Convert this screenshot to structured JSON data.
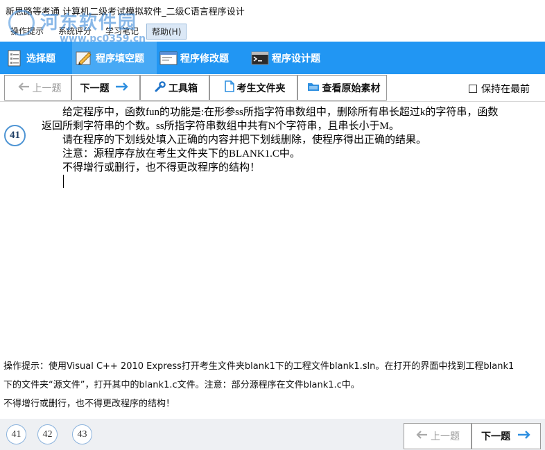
{
  "window": {
    "title": "新思路等考通 计算机二级考试模拟软件_二级C语言程序设计"
  },
  "watermark": {
    "name": "河东软件园",
    "url": "www.pc0359.cn"
  },
  "menu": {
    "items": [
      "操作提示",
      "系统评分",
      "学习笔记"
    ],
    "help": "帮助(H)"
  },
  "modes": [
    {
      "label": "选择题",
      "icon": "document-list-icon",
      "active": false
    },
    {
      "label": "程序填空题",
      "icon": "pencil-edit-icon",
      "active": true
    },
    {
      "label": "程序修改题",
      "icon": "window-edit-icon",
      "active": false
    },
    {
      "label": "程序设计题",
      "icon": "terminal-icon",
      "active": false
    }
  ],
  "toolbar": {
    "prev": "上一题",
    "next": "下一题",
    "tools": "工具箱",
    "exam_folder": "考生文件夹",
    "view_material": "查看原始素材",
    "keep_on_top": "保持在最前"
  },
  "question": {
    "number": "41",
    "lines": [
      "给定程序中，函数fun的功能是:在形参ss所指字符串数组中，删除所有串长超过k的字符串，函数",
      "返回所剩字符串的个数。ss所指字符串数组中共有N个字符串，且串长小于M。",
      "请在程序的下划线处填入正确的内容并把下划线删除，使程序得出正确的结果。",
      "注意：源程序存放在考生文件夹下的BLANK1.C中。",
      "不得增行或删行，也不得更改程序的结构！"
    ]
  },
  "hint": {
    "line1": "操作提示：使用Visual C++ 2010 Express打开考生文件夹blank1下的工程文件blank1.sln。在打开的界面中找到工程blank1",
    "line2": "下的文件夹“源文件”，打开其中的blank1.c文件。注意：部分源程序在文件blank1.c中。",
    "line3": "不得增行或删行，也不得更改程序的结构！"
  },
  "bottom": {
    "questions": [
      "41",
      "42",
      "43"
    ],
    "prev": "上一题",
    "next": "下一题"
  },
  "colors": {
    "mode_bar": "#2196f3",
    "mode_active": "#47a9f5",
    "arrow": "#2e8fe0"
  }
}
